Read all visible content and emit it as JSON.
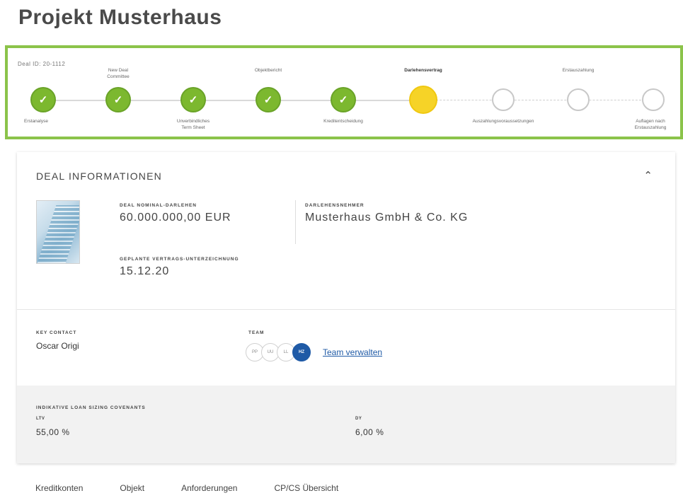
{
  "page": {
    "title": "Projekt Musterhaus"
  },
  "stepper": {
    "deal_id": "Deal ID: 20-1112",
    "steps": [
      {
        "label": "Erstanalyse",
        "status": "done"
      },
      {
        "label": "New Deal Committee",
        "status": "done"
      },
      {
        "label": "Unverbindliches Term Sheet",
        "status": "done"
      },
      {
        "label": "Objektbericht",
        "status": "done"
      },
      {
        "label": "Kreditentscheidung",
        "status": "done"
      },
      {
        "label": "Darlehensvertrag",
        "status": "current"
      },
      {
        "label": "Auszahlungsvoraussetzungen",
        "status": "todo"
      },
      {
        "label": "Erstauszahlung",
        "status": "todo"
      },
      {
        "label": "Auflagen nach Erstauszahlung",
        "status": "todo"
      }
    ],
    "check_glyph": "✓",
    "colors": {
      "done": "#7cb82f",
      "current": "#f6d327",
      "border": "#8bc34a"
    }
  },
  "deal_info": {
    "title": "DEAL INFORMATIONEN",
    "collapse_glyph": "⌃",
    "nominal_label": "DEAL NOMINAL-DARLEHEN",
    "nominal_value": "60.000.000,00 EUR",
    "borrower_label": "DARLEHENSNEHMER",
    "borrower_value": "Musterhaus GmbH & Co. KG",
    "signing_label": "GEPLANTE VERTRAGS-UNTERZEICHNUNG",
    "signing_value": "15.12.20",
    "key_contact_label": "KEY CONTACT",
    "key_contact_value": "Oscar Origi",
    "team_label": "TEAM",
    "team_members": [
      "PP",
      "UU",
      "LL",
      "HZ"
    ],
    "team_link": "Team verwalten"
  },
  "covenants": {
    "title": "INDIKATIVE LOAN SIZING COVENANTS",
    "ltv_label": "LTV",
    "ltv_value": "55,00 %",
    "dy_label": "DY",
    "dy_value": "6,00 %"
  },
  "tabs": [
    "Kreditkonten",
    "Objekt",
    "Anforderungen",
    "CP/CS Übersicht"
  ]
}
